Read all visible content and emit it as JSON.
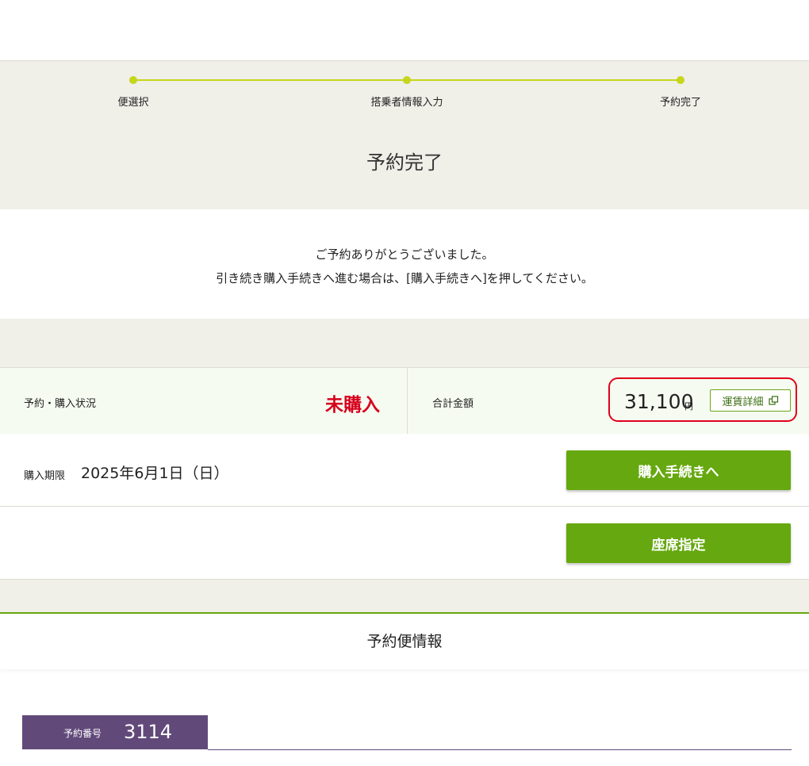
{
  "progress": {
    "steps": [
      {
        "label": "便選択"
      },
      {
        "label": "搭乗者情報入力"
      },
      {
        "label": "予約完了"
      }
    ],
    "color": "#c6d61a"
  },
  "page_title": "予約完了",
  "message": {
    "line1": "ご予約ありがとうございました。",
    "line2": "引き続き購入手続きへ進む場合は、[購入手続きへ]を押してください。"
  },
  "status": {
    "label": "予約・購入状況",
    "value": "未購入",
    "value_color": "#d6001c"
  },
  "total": {
    "label": "合計金額",
    "amount": "31,100",
    "unit": "円",
    "fare_detail_button": "運賃詳細"
  },
  "deadline": {
    "label": "購入期限",
    "value": "2025年6月1日（日）"
  },
  "buttons": {
    "purchase": "購入手続きへ",
    "seat": "座席指定",
    "color": "#66a80f"
  },
  "reservation_info": {
    "title": "予約便情報",
    "number_label": "予約番号",
    "number": "3114",
    "color": "#614a7a"
  },
  "icons": {
    "external": "external-window-icon"
  }
}
